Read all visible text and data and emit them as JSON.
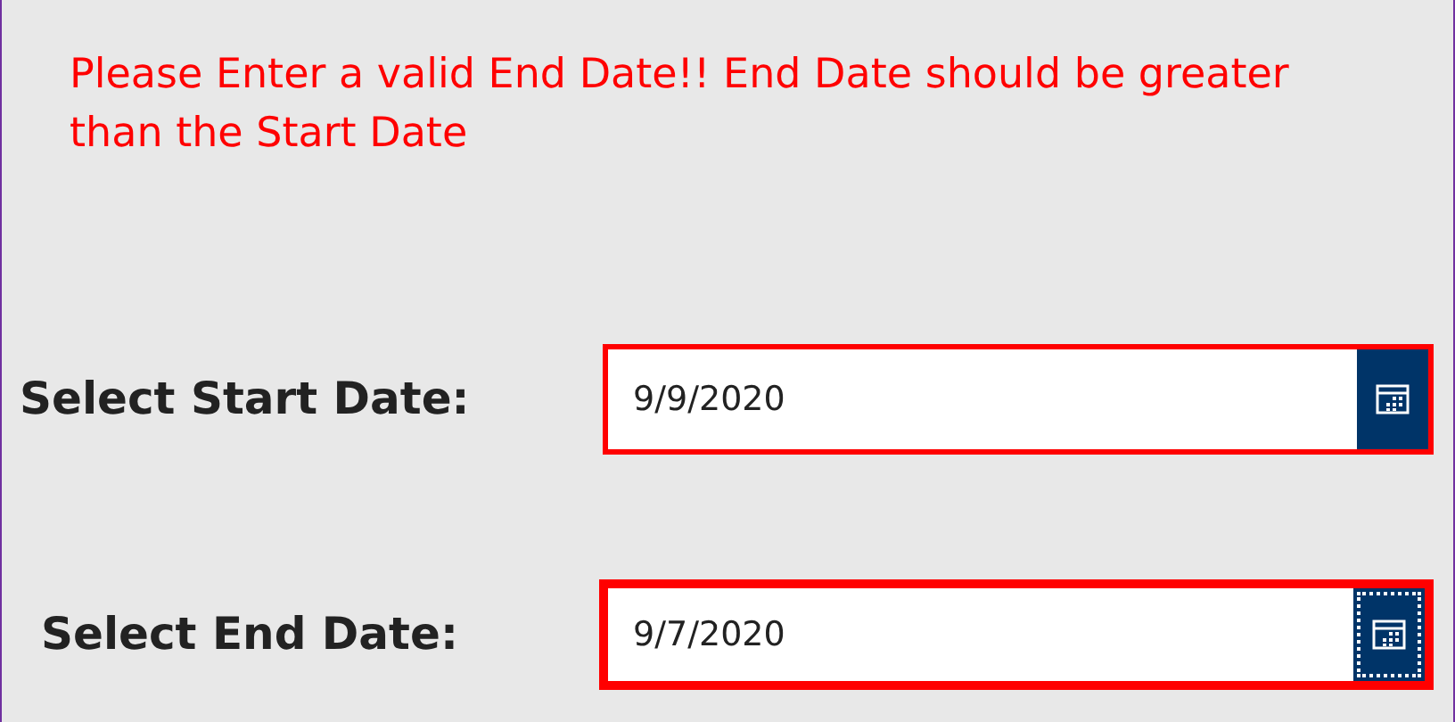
{
  "error_message": "Please Enter a valid End Date!! End Date should be greater than the Start Date",
  "fields": [
    {
      "label": "Select Start Date:",
      "value": "9/9/2020",
      "focused": false
    },
    {
      "label": "Select End Date:",
      "value": "9/7/2020",
      "focused": true
    }
  ]
}
